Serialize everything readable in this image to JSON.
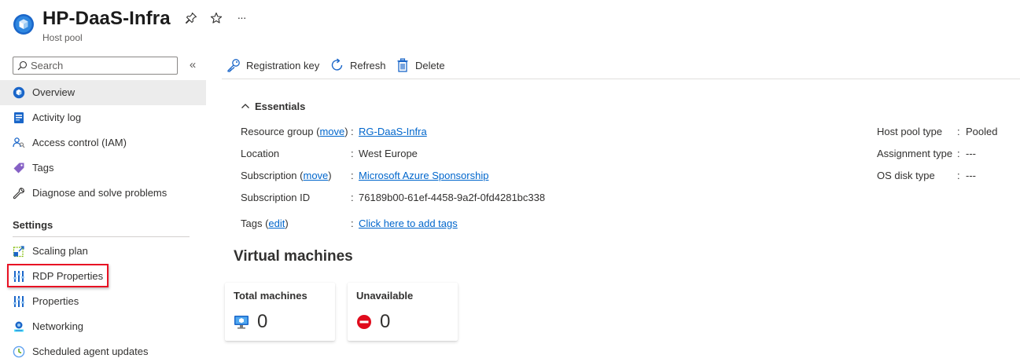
{
  "header": {
    "title": "HP-DaaS-Infra",
    "subtitle": "Host pool",
    "actions": [
      "pin-icon",
      "star-icon",
      "more-icon"
    ],
    "more_label": "···"
  },
  "sidebar": {
    "search_placeholder": "Search",
    "collapse_label": "«",
    "items": [
      {
        "label": "Overview",
        "icon": "host-pool-icon",
        "active": true
      },
      {
        "label": "Activity log",
        "icon": "activity-log-icon"
      },
      {
        "label": "Access control (IAM)",
        "icon": "iam-icon"
      },
      {
        "label": "Tags",
        "icon": "tag-icon"
      },
      {
        "label": "Diagnose and solve problems",
        "icon": "wrench-icon"
      }
    ],
    "settings_heading": "Settings",
    "settings_items": [
      {
        "label": "Scaling plan",
        "icon": "scaling-plan-icon"
      },
      {
        "label": "RDP Properties",
        "icon": "sliders-icon",
        "highlighted": true
      },
      {
        "label": "Properties",
        "icon": "sliders-icon"
      },
      {
        "label": "Networking",
        "icon": "networking-icon"
      },
      {
        "label": "Scheduled agent updates",
        "icon": "clock-icon"
      }
    ]
  },
  "toolbar": {
    "registration_key": "Registration key",
    "refresh": "Refresh",
    "delete": "Delete"
  },
  "essentials": {
    "heading": "Essentials",
    "resource_group_label": "Resource group",
    "resource_group_move": "move",
    "resource_group_value": "RG-DaaS-Infra",
    "location_label": "Location",
    "location_value": "West Europe",
    "subscription_label": "Subscription",
    "subscription_move": "move",
    "subscription_value": "Microsoft Azure Sponsorship",
    "subscription_id_label": "Subscription ID",
    "subscription_id_value": "76189b00-61ef-4458-9a2f-0fd4281bc338",
    "tags_label": "Tags",
    "tags_edit": "edit",
    "tags_value": "Click here to add tags",
    "host_pool_type_label": "Host pool type",
    "host_pool_type_value": "Pooled",
    "assignment_type_label": "Assignment type",
    "assignment_type_value": "---",
    "os_disk_type_label": "OS disk type",
    "os_disk_type_value": "---",
    "separator": ":"
  },
  "virtual_machines": {
    "heading": "Virtual machines",
    "cards": [
      {
        "title": "Total machines",
        "value": "0",
        "icon": "monitor-icon"
      },
      {
        "title": "Unavailable",
        "value": "0",
        "icon": "blocked-icon"
      }
    ]
  },
  "colors": {
    "accent": "#0078d4",
    "link": "#0066cc",
    "highlight_border": "#e81123",
    "error_red": "#e00b1c",
    "active_nav_bg": "#ececec"
  }
}
